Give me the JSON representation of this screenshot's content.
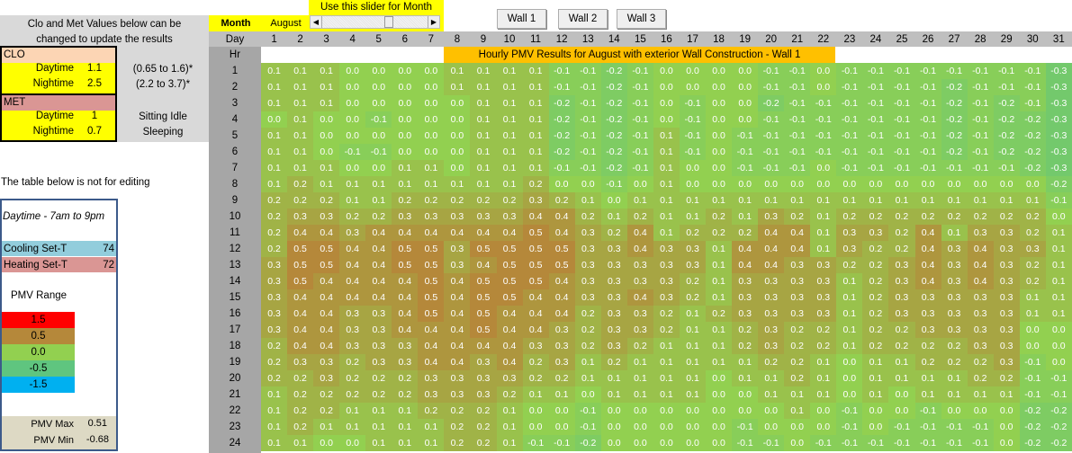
{
  "intro": {
    "line1": "Clo and Met Values below can be",
    "line2": "changed to update the results"
  },
  "clo": {
    "header": "CLO",
    "day_label": "Daytime",
    "day_value": "1.1",
    "night_label": "Nightime",
    "night_value": "2.5",
    "day_range": "(0.65 to 1.6)*",
    "night_range": "(2.2 to 3.7)*"
  },
  "met": {
    "header": "MET",
    "day_label": "Daytime",
    "day_value": "1",
    "night_label": "Nightime",
    "night_value": "0.7",
    "day_desc": "Sitting Idle",
    "night_desc": "Sleeping"
  },
  "not_editing": "The table below is not for editing",
  "panel": {
    "daytime": "Daytime - 7am to 9pm",
    "cooling_label": "Cooling Set-T",
    "cooling_value": "74",
    "heating_label": "Heating Set-T",
    "heating_value": "72",
    "pmv_range_label": "PMV Range",
    "legend": [
      {
        "label": "1.5",
        "color": "#ff0000"
      },
      {
        "label": "0.5",
        "color": "#b5883a"
      },
      {
        "label": "0.0",
        "color": "#92d050"
      },
      {
        "label": "-0.5",
        "color": "#5fc57f"
      },
      {
        "label": "-1.5",
        "color": "#00b0f0"
      }
    ],
    "pmv_max_label": "PMV Max",
    "pmv_max": "0.51",
    "pmv_min_label": "PMV Min",
    "pmv_min": "-0.68"
  },
  "month": {
    "label": "Month",
    "value": "August",
    "slider_hint": "Use this slider for Month",
    "slider_month_index": 8,
    "slider_max": 12
  },
  "buttons": [
    "Wall 1",
    "Wall 2",
    "Wall 3"
  ],
  "day_label": "Day",
  "hr_label": "Hr",
  "title": "Hourly PMV Results for August with exterior Wall Construction - Wall 1",
  "chart_data": {
    "type": "heatmap",
    "x_label": "Day",
    "y_label": "Hr",
    "x": [
      1,
      2,
      3,
      4,
      5,
      6,
      7,
      8,
      9,
      10,
      11,
      12,
      13,
      14,
      15,
      16,
      17,
      18,
      19,
      20,
      21,
      22,
      23,
      24,
      25,
      26,
      27,
      28,
      29,
      30,
      31
    ],
    "y": [
      1,
      2,
      3,
      4,
      5,
      6,
      7,
      8,
      9,
      10,
      11,
      12,
      13,
      14,
      15,
      16,
      17,
      18,
      19,
      20,
      21,
      22,
      23,
      24
    ],
    "values": [
      "0.1 0.1 0.1 0.0 0.0 0.0 0.0 0.1 0.1 0.1 0.1 -0.1 -0.1 -0.2 -0.1 0.0 0.0 0.0 0.0 -0.1 -0.1 0.0 -0.1 -0.1 -0.1 -0.1 -0.1 -0.1 -0.1 -0.1 -0.3",
      "0.1 0.1 0.1 0.0 0.0 0.0 0.0 0.1 0.1 0.1 0.1 -0.1 -0.1 -0.2 -0.1 0.0 0.0 0.0 0.0 -0.1 -0.1 0.0 -0.1 -0.1 -0.1 -0.1 -0.2 -0.1 -0.1 -0.1 -0.3",
      "0.1 0.1 0.1 0.0 0.0 0.0 0.0 0.0 0.1 0.1 0.1 -0.2 -0.1 -0.2 -0.1 0.0 -0.1 0.0 0.0 -0.2 -0.1 -0.1 -0.1 -0.1 -0.1 -0.1 -0.2 -0.1 -0.2 -0.1 -0.3",
      "0.0 0.1 0.0 0.0 -0.1 0.0 0.0 0.0 0.1 0.1 0.1 -0.2 -0.1 -0.2 -0.1 0.0 -0.1 0.0 0.0 -0.1 -0.1 -0.1 -0.1 -0.1 -0.1 -0.1 -0.2 -0.1 -0.2 -0.2 -0.3",
      "0.1 0.1 0.0 0.0 0.0 0.0 0.0 0.0 0.1 0.1 0.1 -0.2 -0.1 -0.2 -0.1 0.1 -0.1 0.0 -0.1 -0.1 -0.1 -0.1 -0.1 -0.1 -0.1 -0.1 -0.2 -0.1 -0.2 -0.2 -0.3",
      "0.1 0.1 0.0 -0.1 -0.1 0.0 0.0 0.0 0.1 0.1 0.1 -0.2 -0.1 -0.2 -0.1 0.1 -0.1 0.0 -0.1 -0.1 -0.1 -0.1 -0.1 -0.1 -0.1 -0.1 -0.2 -0.1 -0.2 -0.2 -0.3",
      "0.1 0.1 0.1 0.0 0.0 0.1 0.1 0.0 0.1 0.1 0.1 -0.1 -0.1 -0.2 -0.1 0.1 0.0 0.0 -0.1 -0.1 -0.1 0.0 -0.1 -0.1 -0.1 -0.1 -0.1 -0.1 -0.1 -0.2 -0.3",
      "0.1 0.2 0.1 0.1 0.1 0.1 0.1 0.1 0.1 0.1 0.2 0.0 0.0 -0.1 0.0 0.1 0.0 0.0 0.0 0.0 0.0 0.0 0.0 0.0 0.0 0.0 0.0 0.0 0.0 0.0 -0.2",
      "0.2 0.2 0.2 0.1 0.1 0.2 0.2 0.2 0.2 0.2 0.3 0.2 0.1 0.0 0.1 0.1 0.1 0.1 0.1 0.1 0.1 0.1 0.1 0.1 0.1 0.1 0.1 0.1 0.1 0.1 -0.1",
      "0.2 0.3 0.3 0.2 0.2 0.3 0.3 0.3 0.3 0.3 0.4 0.4 0.2 0.1 0.2 0.1 0.1 0.2 0.1 0.3 0.2 0.1 0.2 0.2 0.2 0.2 0.2 0.2 0.2 0.2 0.0",
      "0.2 0.4 0.4 0.3 0.4 0.4 0.4 0.4 0.4 0.4 0.5 0.4 0.3 0.2 0.4 0.1 0.2 0.2 0.2 0.4 0.4 0.1 0.3 0.3 0.2 0.4 0.1 0.3 0.3 0.2 0.1",
      "0.2 0.5 0.5 0.4 0.4 0.5 0.5 0.3 0.5 0.5 0.5 0.5 0.3 0.3 0.4 0.3 0.3 0.1 0.4 0.4 0.4 0.1 0.3 0.2 0.2 0.4 0.3 0.4 0.3 0.3 0.1",
      "0.3 0.5 0.5 0.4 0.4 0.5 0.5 0.3 0.4 0.5 0.5 0.5 0.3 0.3 0.3 0.3 0.3 0.1 0.4 0.4 0.3 0.3 0.2 0.2 0.3 0.4 0.3 0.4 0.3 0.2 0.1",
      "0.3 0.5 0.4 0.4 0.4 0.4 0.5 0.4 0.5 0.5 0.5 0.4 0.3 0.3 0.3 0.3 0.2 0.1 0.3 0.3 0.3 0.3 0.1 0.2 0.3 0.4 0.3 0.4 0.3 0.2 0.1",
      "0.3 0.4 0.4 0.4 0.4 0.4 0.5 0.4 0.5 0.5 0.4 0.4 0.3 0.3 0.4 0.3 0.2 0.1 0.3 0.3 0.3 0.3 0.1 0.2 0.3 0.3 0.3 0.3 0.3 0.1 0.1",
      "0.3 0.4 0.4 0.3 0.3 0.4 0.5 0.4 0.5 0.4 0.4 0.4 0.2 0.3 0.3 0.2 0.1 0.2 0.3 0.3 0.3 0.3 0.1 0.2 0.3 0.3 0.3 0.3 0.3 0.1 0.1",
      "0.3 0.4 0.4 0.3 0.3 0.4 0.4 0.4 0.5 0.4 0.4 0.3 0.2 0.3 0.3 0.2 0.1 0.1 0.2 0.3 0.2 0.2 0.1 0.2 0.2 0.3 0.3 0.3 0.3 0.0 0.0",
      "0.2 0.4 0.4 0.3 0.3 0.3 0.4 0.4 0.4 0.4 0.3 0.3 0.2 0.3 0.2 0.1 0.1 0.1 0.2 0.3 0.2 0.2 0.1 0.2 0.2 0.2 0.2 0.3 0.3 0.0 0.0",
      "0.2 0.3 0.3 0.2 0.3 0.3 0.4 0.4 0.3 0.4 0.2 0.3 0.1 0.2 0.1 0.1 0.1 0.1 0.1 0.2 0.2 0.1 0.0 0.1 0.1 0.2 0.2 0.2 0.3 -0.1 0.0",
      "0.2 0.2 0.3 0.2 0.2 0.2 0.3 0.3 0.3 0.3 0.2 0.2 0.1 0.1 0.1 0.1 0.1 0.0 0.1 0.1 0.2 0.1 0.0 0.1 0.1 0.1 0.1 0.2 0.2 -0.1 -0.1",
      "0.1 0.2 0.2 0.2 0.2 0.2 0.3 0.3 0.3 0.2 0.1 0.1 0.0 0.1 0.1 0.1 0.1 0.0 0.0 0.1 0.1 0.1 0.0 0.1 0.0 0.1 0.1 0.1 0.1 -0.1 -0.1",
      "0.1 0.2 0.2 0.1 0.1 0.1 0.2 0.2 0.2 0.1 0.0 0.0 -0.1 0.0 0.0 0.0 0.0 0.0 0.0 0.0 0.1 0.0 -0.1 0.0 0.0 -0.1 0.0 0.0 0.0 -0.2 -0.2",
      "0.1 0.2 0.1 0.1 0.1 0.1 0.1 0.2 0.2 0.1 0.0 0.0 -0.1 0.0 0.0 0.0 0.0 0.0 -0.1 0.0 0.0 0.0 -0.1 0.0 -0.1 -0.1 -0.1 -0.1 0.0 -0.2 -0.2",
      "0.1 0.1 0.0 0.0 0.1 0.1 0.1 0.2 0.2 0.1 -0.1 -0.1 -0.2 0.0 0.0 0.0 0.0 0.0 -0.1 -0.1 0.0 -0.1 -0.1 -0.1 -0.1 -0.1 -0.1 -0.1 0.0 -0.2 -0.2"
    ],
    "color_scale": {
      "-0.5": "#5fc57f",
      "0.0": "#92d050",
      "0.5": "#b5883a"
    }
  }
}
